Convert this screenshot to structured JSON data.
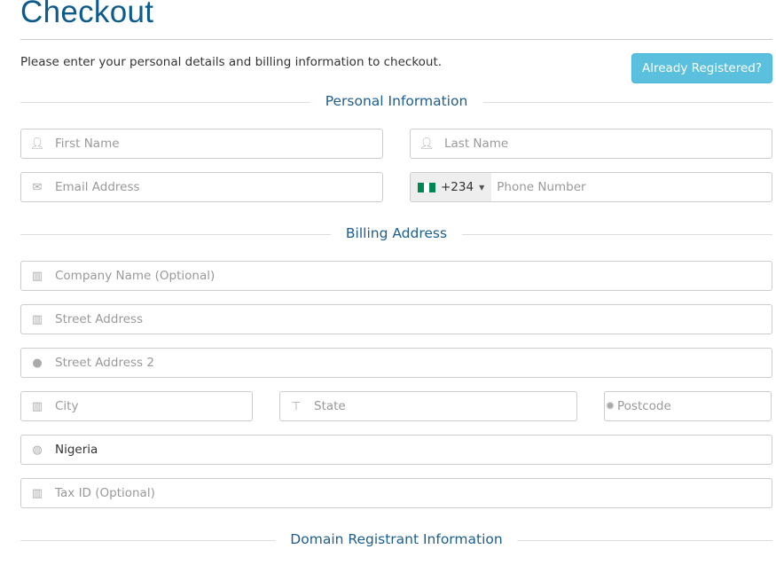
{
  "title": "Checkout",
  "intro": "Please enter your personal details and billing information to checkout.",
  "already_registered": "Already Registered?",
  "sections": {
    "personal": "Personal Information",
    "billing": "Billing Address",
    "domain": "Domain Registrant Information"
  },
  "fields": {
    "first_name": {
      "placeholder": "First Name",
      "icon": "user-icon"
    },
    "last_name": {
      "placeholder": "Last Name",
      "icon": "user-icon"
    },
    "email": {
      "placeholder": "Email Address",
      "icon": "envelope-icon"
    },
    "phone": {
      "placeholder": "Phone Number",
      "country_code": "+234",
      "flag": "nigeria-flag"
    },
    "company": {
      "placeholder": "Company Name (Optional)",
      "icon": "building-icon"
    },
    "street": {
      "placeholder": "Street Address",
      "icon": "building-icon"
    },
    "street2": {
      "placeholder": "Street Address 2",
      "icon": "map-marker-icon"
    },
    "city": {
      "placeholder": "City",
      "icon": "building-icon"
    },
    "state": {
      "placeholder": "State",
      "icon": "signpost-icon"
    },
    "postcode": {
      "placeholder": "Postcode",
      "icon": "certificate-icon"
    },
    "country": {
      "value": "Nigeria",
      "icon": "globe-icon"
    },
    "tax_id": {
      "placeholder": "Tax ID (Optional)",
      "icon": "building-icon"
    }
  },
  "colors": {
    "accent": "#0d5a8c",
    "button": "#5bc0de"
  }
}
